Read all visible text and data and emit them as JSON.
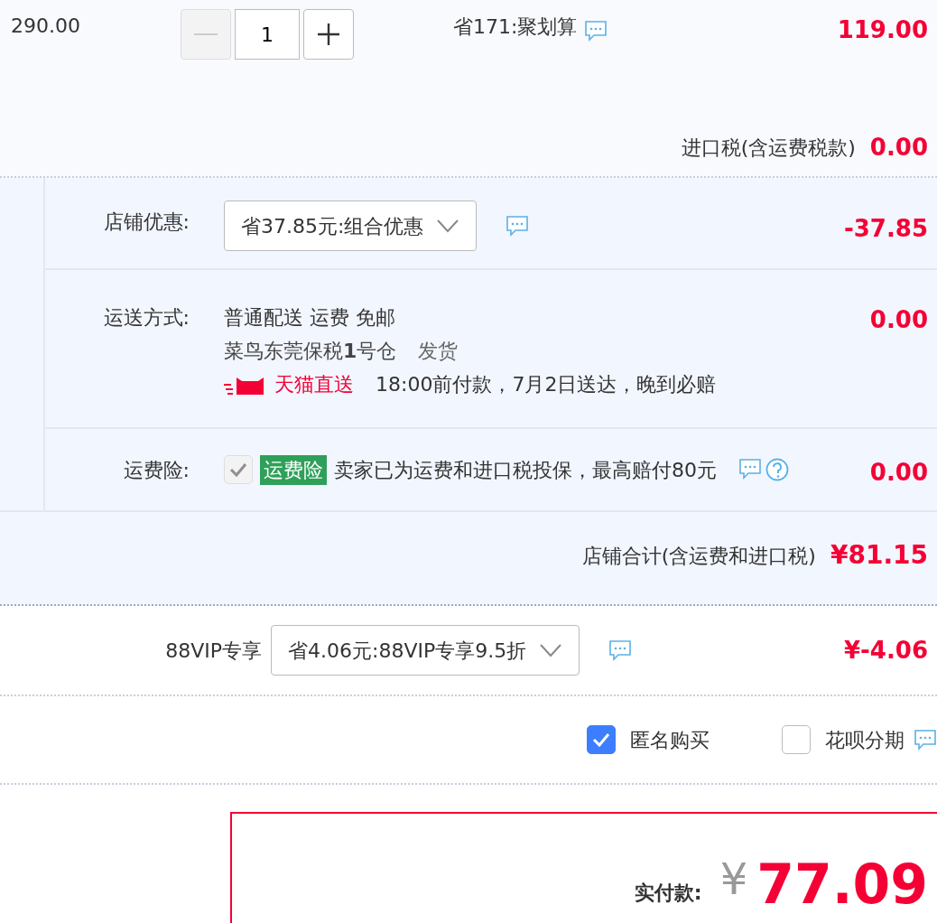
{
  "item": {
    "price": "290.00",
    "quantity": "1",
    "minus_disabled": true,
    "promo": "省171:聚划算",
    "subtotal": "119.00",
    "tax_label": "进口税(含运费税款)",
    "tax": "0.00"
  },
  "store": {
    "rows": [
      {
        "kind": "select",
        "label": "店铺优惠:",
        "value": "省37.85元:组合优惠",
        "amount": "-37.85"
      },
      {
        "kind": "shipping",
        "label": "运送方式:",
        "method": "普通配送 运费 免邮",
        "warehouse": "菜鸟东莞保税**1**号仓",
        "dispatch": "发货",
        "badge": "天猫直送",
        "promise": "18:00前付款，7月2日送达，晚到必赔",
        "amount": "0.00"
      },
      {
        "kind": "insurance",
        "label": "运费险:",
        "checked": true,
        "disabled": true,
        "tag": "运费险",
        "text": "卖家已为运费和进口税投保，最高赔付80元",
        "amount": "0.00"
      }
    ],
    "total_label": "店铺合计(含运费和进口税)",
    "total": "¥81.15"
  },
  "vip": {
    "label": "88VIP专享",
    "value": "省4.06元:88VIP专享9.5折",
    "amount": "¥-4.06"
  },
  "options": [
    {
      "label": "匿名购买",
      "checked": true
    },
    {
      "label": "花呗分期",
      "checked": false
    }
  ],
  "payment": {
    "label": "实付款:",
    "currency": "¥",
    "amount": "77.09"
  }
}
